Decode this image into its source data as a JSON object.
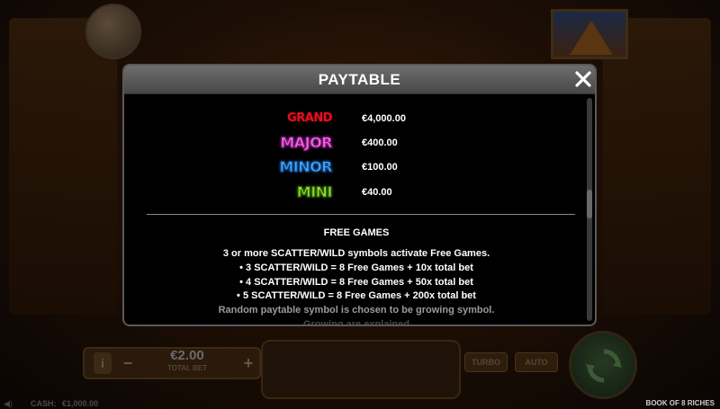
{
  "modal": {
    "title": "PAYTABLE",
    "jackpots": [
      {
        "name": "GRAND",
        "amount": "€4,000.00",
        "color": "#e3101f"
      },
      {
        "name": "MAJOR",
        "amount": "€400.00",
        "color": "#f46ae8"
      },
      {
        "name": "MINOR",
        "amount": "€100.00",
        "color": "#44a8ff"
      },
      {
        "name": "MINI",
        "amount": "€40.00",
        "color": "#8ee02a"
      }
    ],
    "free_games": {
      "heading": "FREE GAMES",
      "intro": "3 or more SCATTER/WILD symbols activate Free Games.",
      "bullets": [
        "• 3 SCATTER/WILD = 8 Free Games + 10x total bet",
        "• 4 SCATTER/WILD = 8 Free Games + 50x total bet",
        "• 5 SCATTER/WILD = 8 Free Games + 200x total bet"
      ],
      "note": "Random paytable symbol is chosen to be growing symbol.",
      "note2": "Growing are explained"
    }
  },
  "controls": {
    "bet_value": "€2.00",
    "bet_label": "TOTAL BET",
    "turbo_label": "TURBO",
    "auto_label": "AUTO",
    "cash_label": "CASH:",
    "cash_value": "€1,000.00",
    "game_title": "BOOK OF 8 RICHES"
  },
  "icons": {
    "close": "close-icon",
    "spin": "spin-icon",
    "info": "info-icon"
  }
}
